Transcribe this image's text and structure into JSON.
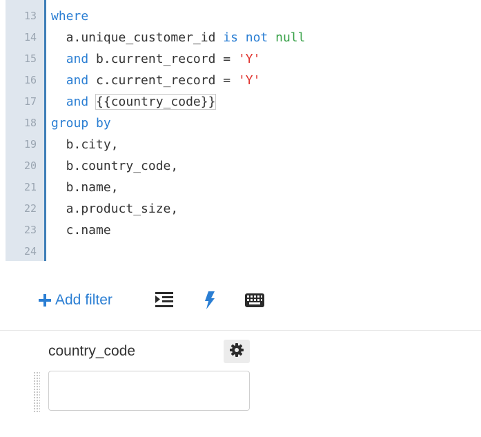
{
  "editor": {
    "lines": [
      {
        "num": "13",
        "parts": [
          {
            "text": "where",
            "cls": "kw"
          }
        ]
      },
      {
        "num": "14",
        "parts": [
          {
            "text": "  a.unique_customer_id ",
            "cls": ""
          },
          {
            "text": "is not",
            "cls": "kw"
          },
          {
            "text": " ",
            "cls": ""
          },
          {
            "text": "null",
            "cls": "null"
          }
        ]
      },
      {
        "num": "15",
        "parts": [
          {
            "text": "  ",
            "cls": ""
          },
          {
            "text": "and",
            "cls": "kw"
          },
          {
            "text": " b.current_record = ",
            "cls": ""
          },
          {
            "text": "'Y'",
            "cls": "str"
          }
        ]
      },
      {
        "num": "16",
        "parts": [
          {
            "text": "  ",
            "cls": ""
          },
          {
            "text": "and",
            "cls": "kw"
          },
          {
            "text": " c.current_record = ",
            "cls": ""
          },
          {
            "text": "'Y'",
            "cls": "str"
          }
        ]
      },
      {
        "num": "17",
        "parts": [
          {
            "text": "  ",
            "cls": ""
          },
          {
            "text": "and",
            "cls": "kw"
          },
          {
            "text": " ",
            "cls": ""
          },
          {
            "text": "{{country_code}}",
            "cls": "cursor-box"
          }
        ]
      },
      {
        "num": "18",
        "parts": [
          {
            "text": "group by",
            "cls": "kw"
          }
        ]
      },
      {
        "num": "19",
        "parts": [
          {
            "text": "  b.city,",
            "cls": ""
          }
        ]
      },
      {
        "num": "20",
        "parts": [
          {
            "text": "  b.country_code,",
            "cls": ""
          }
        ]
      },
      {
        "num": "21",
        "parts": [
          {
            "text": "  b.name,",
            "cls": ""
          }
        ]
      },
      {
        "num": "22",
        "parts": [
          {
            "text": "  a.product_size,",
            "cls": ""
          }
        ]
      },
      {
        "num": "23",
        "parts": [
          {
            "text": "  c.name",
            "cls": ""
          }
        ]
      },
      {
        "num": "24",
        "parts": [
          {
            "text": "",
            "cls": ""
          }
        ]
      }
    ]
  },
  "toolbar": {
    "add_filter_label": "Add filter",
    "icons": [
      "plus-icon",
      "indent-icon",
      "bolt-icon",
      "keyboard-icon"
    ]
  },
  "filter": {
    "label": "country_code",
    "value": "",
    "icons": [
      "gear-icon",
      "drag-handle-icon"
    ]
  },
  "colors": {
    "keyword": "#2a7ed3",
    "string": "#e0342f",
    "null": "#3aa24a",
    "gutter": "#dfe6ee",
    "gutter_edge": "#3f7fb8"
  }
}
